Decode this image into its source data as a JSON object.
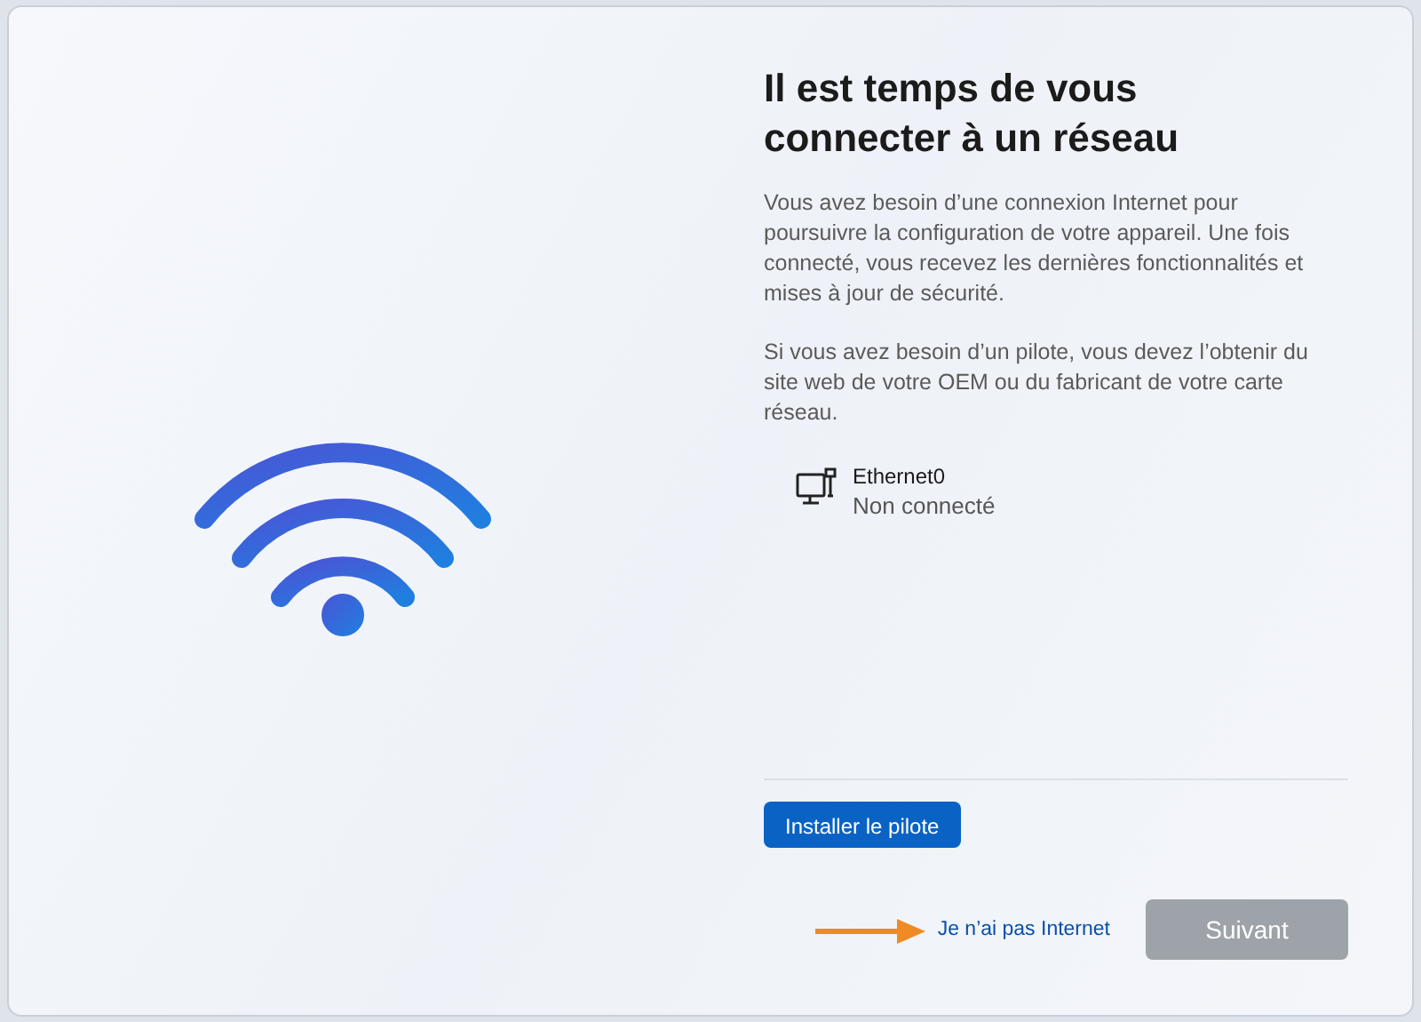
{
  "title": "Il est temps de vous connecter à un réseau",
  "paragraphs": [
    "Vous avez besoin d’une connexion Internet pour poursuivre la configuration de votre appareil. Une fois connecté, vous recevez les dernières fonctionnalités et mises à jour de sécurité.",
    "Si vous avez besoin d’un pilote, vous devez l’obtenir du site web de votre OEM ou du fabricant de votre carte réseau."
  ],
  "networks": [
    {
      "name": "Ethernet0",
      "status": "Non connecté",
      "kind": "ethernet"
    }
  ],
  "install_button": {
    "label": "Installer le pilote",
    "disabled": false
  },
  "no_internet_link": "Je n’ai pas Internet",
  "next_button": {
    "label": "Suivant",
    "disabled": true
  }
}
